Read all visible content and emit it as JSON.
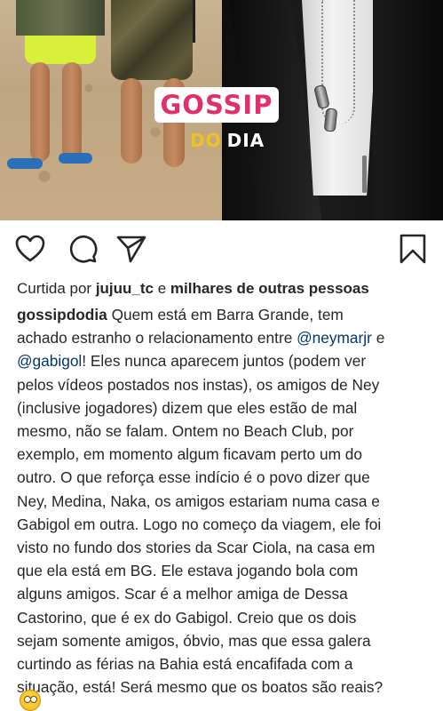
{
  "photo": {
    "badge_gossip": "GOSSIP",
    "badge_do": "DO",
    "badge_dia": "DIA"
  },
  "actions": {
    "like": "heart-icon",
    "comment": "comment-icon",
    "share": "send-icon",
    "save": "bookmark-icon"
  },
  "likes": {
    "prefix": "Curtida por ",
    "user": "jujuu_tc",
    "middle": " e ",
    "rest": "milhares de outras pessoas"
  },
  "caption": {
    "username": "gossipdodia",
    "line1_text": " Quem está em Barra Grande, tem",
    "line2_text": "achado estranho o relacionamento entre ",
    "line2_mention": "@neymarjr",
    "line2_tail": " e",
    "line3_mention": "@gabigol",
    "line3_text": "! Eles nunca aparecem juntos (podem ver",
    "lines": [
      "pelos vídeos postados nos instas), os amigos de Ney",
      "(inclusive jogadores) dizem que eles estão de mal",
      "mesmo, não se falam. Ontem no Beach Club, por",
      "exemplo, em momento algum ficavam perto um do",
      "outro. O que reforça esse indício é o povo dizer que",
      "Ney, Medina, Naka, os amigos estariam numa casa e",
      "Gabigol em outra. Logo no começo da viagem, ele foi",
      "visto no fundo dos stories da Scar Ciola, na casa em",
      "que ela está em BG. Ele estava jogando bola com",
      "alguns amigos. Scar é a melhor amiga de Dessa",
      "Castorino, que é ex do Gabigol. Creio que os dois",
      "sejam somente amigos, óbvio, mas que essa galera",
      "curtindo as férias na Bahia está encafifada com a",
      "situação, está! Será mesmo que os boatos são reais?"
    ]
  },
  "colors": {
    "text": "#262626",
    "mention": "#00376b",
    "badge_pink": "#e0306a",
    "badge_gold": "#f0c21f"
  }
}
